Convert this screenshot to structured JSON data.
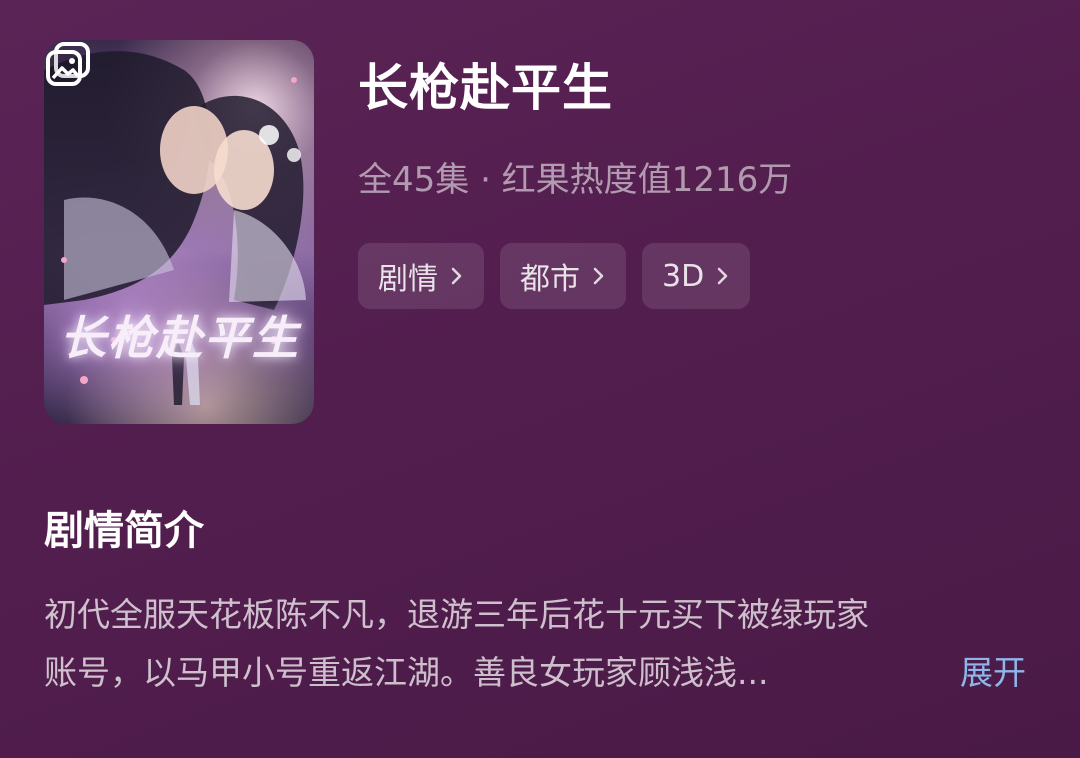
{
  "poster": {
    "title_art": "长枪赴平生",
    "gallery_icon": "gallery-icon"
  },
  "drama": {
    "title": "长枪赴平生",
    "meta": "全45集 · 红果热度值1216万"
  },
  "tags": [
    {
      "label": "剧情"
    },
    {
      "label": "都市"
    },
    {
      "label": "3D"
    }
  ],
  "synopsis": {
    "heading": "剧情简介",
    "line1": "初代全服天花板陈不凡，退游三年后花十元买下被绿玩家",
    "line2": "账号，以马甲小号重返江湖。善良女玩家顾浅浅...",
    "expand_label": "展开"
  },
  "colors": {
    "background": "#521e4e",
    "expand_link": "#8fb6ea"
  }
}
